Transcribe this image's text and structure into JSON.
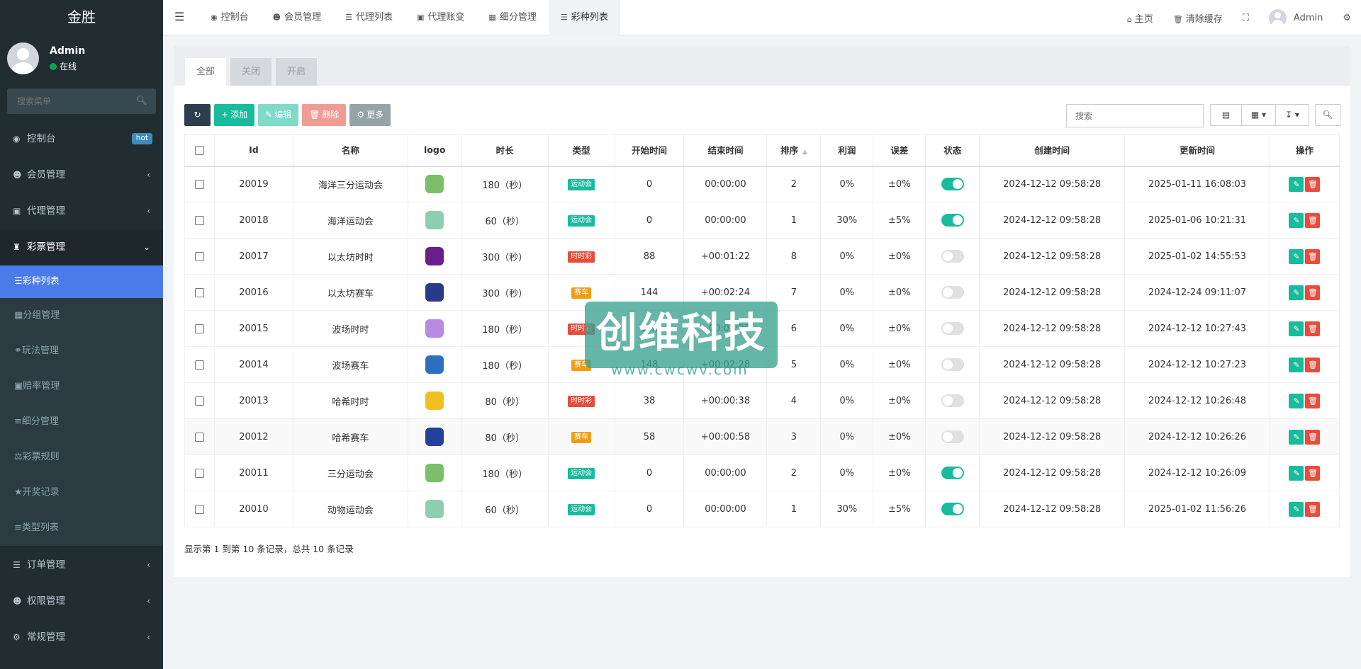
{
  "sidebar": {
    "brand": "金胜",
    "user": {
      "name": "Admin",
      "status": "在线"
    },
    "search_placeholder": "搜索菜单",
    "menu": [
      {
        "label": "控制台",
        "icon": "dashboard-icon",
        "badge": "hot"
      },
      {
        "label": "会员管理",
        "icon": "user-circle-icon"
      },
      {
        "label": "代理管理",
        "icon": "agent-icon"
      },
      {
        "label": "彩票管理",
        "icon": "lottery-icon",
        "open": true
      }
    ],
    "submenu": [
      {
        "label": "彩种列表",
        "active": true
      },
      {
        "label": "分组管理"
      },
      {
        "label": "玩法管理"
      },
      {
        "label": "赔率管理"
      },
      {
        "label": "细分管理"
      },
      {
        "label": "彩票规则"
      },
      {
        "label": "开奖记录"
      },
      {
        "label": "类型列表"
      }
    ],
    "menu_after": [
      {
        "label": "订单管理"
      },
      {
        "label": "权限管理"
      },
      {
        "label": "常规管理"
      }
    ]
  },
  "topbar": {
    "tabs": [
      "控制台",
      "会员管理",
      "代理列表",
      "代理账变",
      "细分管理",
      "彩种列表"
    ],
    "active_tab": "彩种列表",
    "home": "主页",
    "clear_cache": "清除缓存",
    "user": "Admin"
  },
  "filter_tabs": [
    "全部",
    "关闭",
    "开启"
  ],
  "toolbar": {
    "add": "添加",
    "edit": "编辑",
    "delete": "删除",
    "more": "更多"
  },
  "search_placeholder": "搜索",
  "table": {
    "headers": [
      "Id",
      "名称",
      "logo",
      "时长",
      "类型",
      "开始时间",
      "结束时间",
      "排序",
      "利润",
      "误差",
      "状态",
      "创建时间",
      "更新时间",
      "操作"
    ],
    "rows": [
      {
        "id": "20019",
        "name": "海洋三分运动会",
        "duration": "180（秒）",
        "type": "运动会",
        "type_color": "#18bc9c",
        "start": "0",
        "end": "00:00:00",
        "sort": "2",
        "profit": "0%",
        "error": "±0%",
        "status": true,
        "created": "2024-12-12 09:58:28",
        "updated": "2025-01-11 16:08:03",
        "logo_color": "#7bbf6a"
      },
      {
        "id": "20018",
        "name": "海洋运动会",
        "duration": "60（秒）",
        "type": "运动会",
        "type_color": "#18bc9c",
        "start": "0",
        "end": "00:00:00",
        "sort": "1",
        "profit": "30%",
        "error": "±5%",
        "status": true,
        "created": "2024-12-12 09:58:28",
        "updated": "2025-01-06 10:21:31",
        "logo_color": "#8ccfb0"
      },
      {
        "id": "20017",
        "name": "以太坊时时",
        "duration": "300（秒）",
        "type": "时时彩",
        "type_color": "#e74c3c",
        "start": "88",
        "end": "+00:01:22",
        "sort": "8",
        "profit": "0%",
        "error": "±0%",
        "status": false,
        "created": "2024-12-12 09:58:28",
        "updated": "2025-01-02 14:55:53",
        "logo_color": "#6a1e8a"
      },
      {
        "id": "20016",
        "name": "以太坊赛车",
        "duration": "300（秒）",
        "type": "赛车",
        "type_color": "#f39c12",
        "start": "144",
        "end": "+00:02:24",
        "sort": "7",
        "profit": "0%",
        "error": "±0%",
        "status": false,
        "created": "2024-12-12 09:58:28",
        "updated": "2024-12-24 09:11:07",
        "logo_color": "#2a3a8a"
      },
      {
        "id": "20015",
        "name": "波场时时",
        "duration": "180（秒）",
        "type": "时时彩",
        "type_color": "#e74c3c",
        "start": "148",
        "end": "+00:02:28",
        "sort": "6",
        "profit": "0%",
        "error": "±0%",
        "status": false,
        "created": "2024-12-12 09:58:28",
        "updated": "2024-12-12 10:27:43",
        "logo_color": "#b98ae0"
      },
      {
        "id": "20014",
        "name": "波场赛车",
        "duration": "180（秒）",
        "type": "赛车",
        "type_color": "#f39c12",
        "start": "148",
        "end": "+00:02:28",
        "sort": "5",
        "profit": "0%",
        "error": "±0%",
        "status": false,
        "created": "2024-12-12 09:58:28",
        "updated": "2024-12-12 10:27:23",
        "logo_color": "#2d6fc0"
      },
      {
        "id": "20013",
        "name": "哈希时时",
        "duration": "80（秒）",
        "type": "时时彩",
        "type_color": "#e74c3c",
        "start": "38",
        "end": "+00:00:38",
        "sort": "4",
        "profit": "0%",
        "error": "±0%",
        "status": false,
        "created": "2024-12-12 09:58:28",
        "updated": "2024-12-12 10:26:48",
        "logo_color": "#f0c020"
      },
      {
        "id": "20012",
        "name": "哈希赛车",
        "duration": "80（秒）",
        "type": "赛车",
        "type_color": "#f39c12",
        "start": "58",
        "end": "+00:00:58",
        "sort": "3",
        "profit": "0%",
        "error": "±0%",
        "status": false,
        "created": "2024-12-12 09:58:28",
        "updated": "2024-12-12 10:26:26",
        "logo_color": "#2440a0"
      },
      {
        "id": "20011",
        "name": "三分运动会",
        "duration": "180（秒）",
        "type": "运动会",
        "type_color": "#18bc9c",
        "start": "0",
        "end": "00:00:00",
        "sort": "2",
        "profit": "0%",
        "error": "±0%",
        "status": true,
        "created": "2024-12-12 09:58:28",
        "updated": "2024-12-12 10:26:09",
        "logo_color": "#7bbf6a"
      },
      {
        "id": "20010",
        "name": "动物运动会",
        "duration": "60（秒）",
        "type": "运动会",
        "type_color": "#18bc9c",
        "start": "0",
        "end": "00:00:00",
        "sort": "1",
        "profit": "30%",
        "error": "±5%",
        "status": true,
        "created": "2024-12-12 09:58:28",
        "updated": "2025-01-02 11:56:26",
        "logo_color": "#8ccfb0"
      }
    ]
  },
  "pager_info": "显示第 1 到第 10 条记录，总共 10 条记录",
  "watermark": {
    "title": "创维科技",
    "url": "www.cwcwv.com"
  }
}
